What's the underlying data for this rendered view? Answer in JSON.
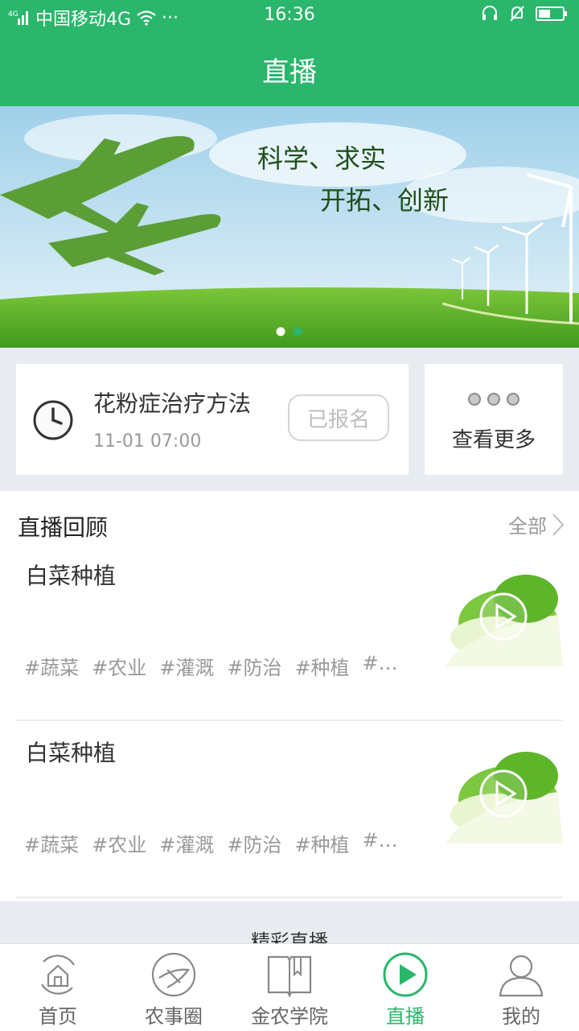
{
  "status_bar": {
    "carrier": "中国移动4G",
    "network_type": "4G",
    "time": "16:36",
    "more": "···"
  },
  "header": {
    "title": "直播"
  },
  "banner": {
    "line1": "科学、求实",
    "line2": "开拓、创新",
    "page_count": 2,
    "active_index": 1
  },
  "upcoming": {
    "title": "花粉症治疗方法",
    "time": "11-01 07:00",
    "status_button": "已报名",
    "more_label": "查看更多"
  },
  "replay": {
    "heading": "直播回顾",
    "all_link": "全部",
    "items": [
      {
        "title": "白菜种植",
        "tags": [
          "#蔬菜",
          "#农业",
          "#灌溉",
          "#防治",
          "#种植",
          "#…"
        ]
      },
      {
        "title": "白菜种植",
        "tags": [
          "#蔬菜",
          "#农业",
          "#灌溉",
          "#防治",
          "#种植",
          "#…"
        ]
      }
    ]
  },
  "next_section": {
    "title": "精彩直播"
  },
  "tabbar": {
    "tabs": [
      {
        "label": "首页",
        "icon": "home-icon"
      },
      {
        "label": "农事圈",
        "icon": "circle-icon"
      },
      {
        "label": "金农学院",
        "icon": "book-icon"
      },
      {
        "label": "直播",
        "icon": "play-icon"
      },
      {
        "label": "我的",
        "icon": "user-icon"
      }
    ],
    "active_tab": "直播"
  },
  "colors": {
    "accent": "#2ab66b",
    "text_primary": "#333333",
    "text_secondary": "#999999",
    "background": "#e8ecf1"
  }
}
